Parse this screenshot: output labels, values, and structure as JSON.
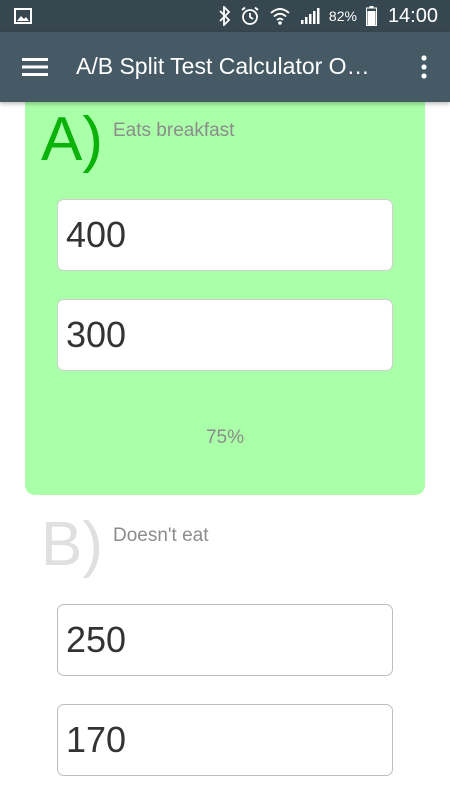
{
  "status_bar": {
    "icons": [
      "gallery-icon",
      "bluetooth-icon",
      "alarm-icon",
      "wifi-icon",
      "signal-icon",
      "battery-icon"
    ],
    "battery": "82%",
    "time": "14:00"
  },
  "app_bar": {
    "title": "A/B Split Test Calculator O…",
    "menu_icon": "hamburger-menu-icon",
    "more_icon": "more-vert-icon"
  },
  "variants": [
    {
      "letter": "A)",
      "name": "Eats breakfast",
      "visitors": "400",
      "conversions": "300",
      "rate": "75%",
      "letter_color": "#0ab20a",
      "background": "#aaffa9"
    },
    {
      "letter": "B)",
      "name": "Doesn't eat",
      "visitors": "250",
      "conversions": "170",
      "letter_color": "#e0e0e0",
      "background": "#ffffff"
    }
  ],
  "colors": {
    "status_bar": "#37474f",
    "app_bar": "#455a64",
    "winner_card": "#aaffa9",
    "winner_letter": "#0ab20a"
  }
}
